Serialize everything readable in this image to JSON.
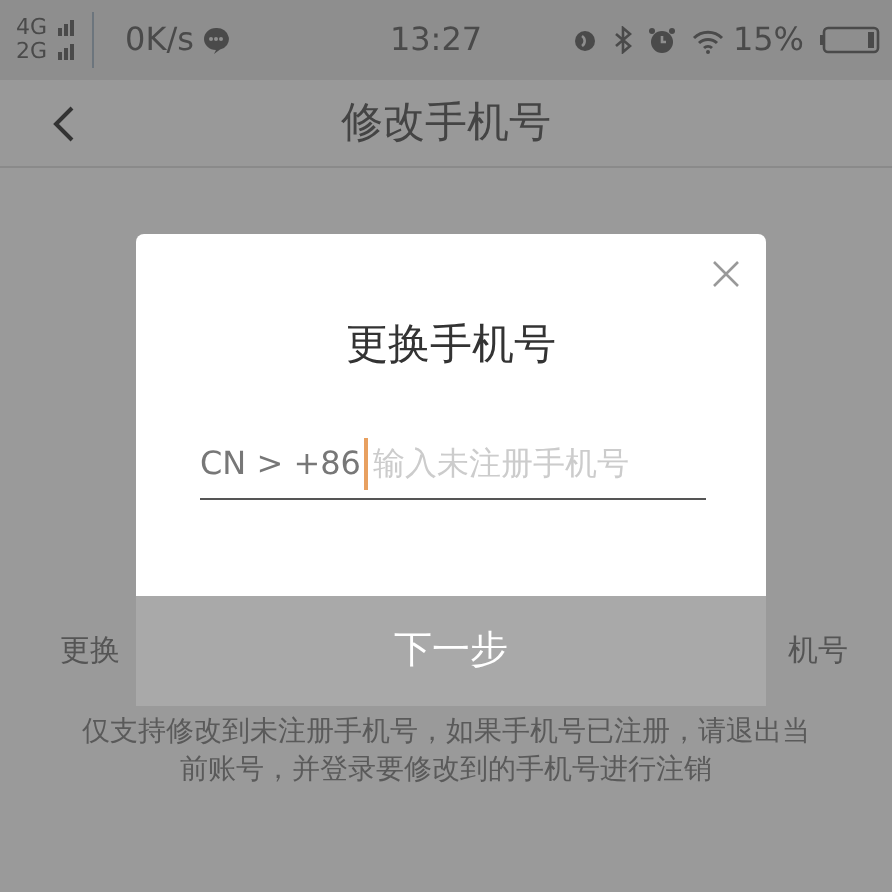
{
  "status_bar": {
    "network_top": "4G",
    "network_bottom": "2G",
    "speed": "0K/s",
    "time": "13:27",
    "battery": "15%"
  },
  "header": {
    "title": "修改手机号"
  },
  "background_page": {
    "line_left": "更换",
    "line_right": "机号",
    "note": "仅支持修改到未注册手机号，如果手机号已注册，请退出当前账号，并登录要修改到的手机号进行注销"
  },
  "dialog": {
    "title": "更换手机号",
    "prefix": "CN > +86",
    "placeholder": "输入未注册手机号",
    "button": {
      "label": "下一步",
      "disabled": true
    }
  }
}
